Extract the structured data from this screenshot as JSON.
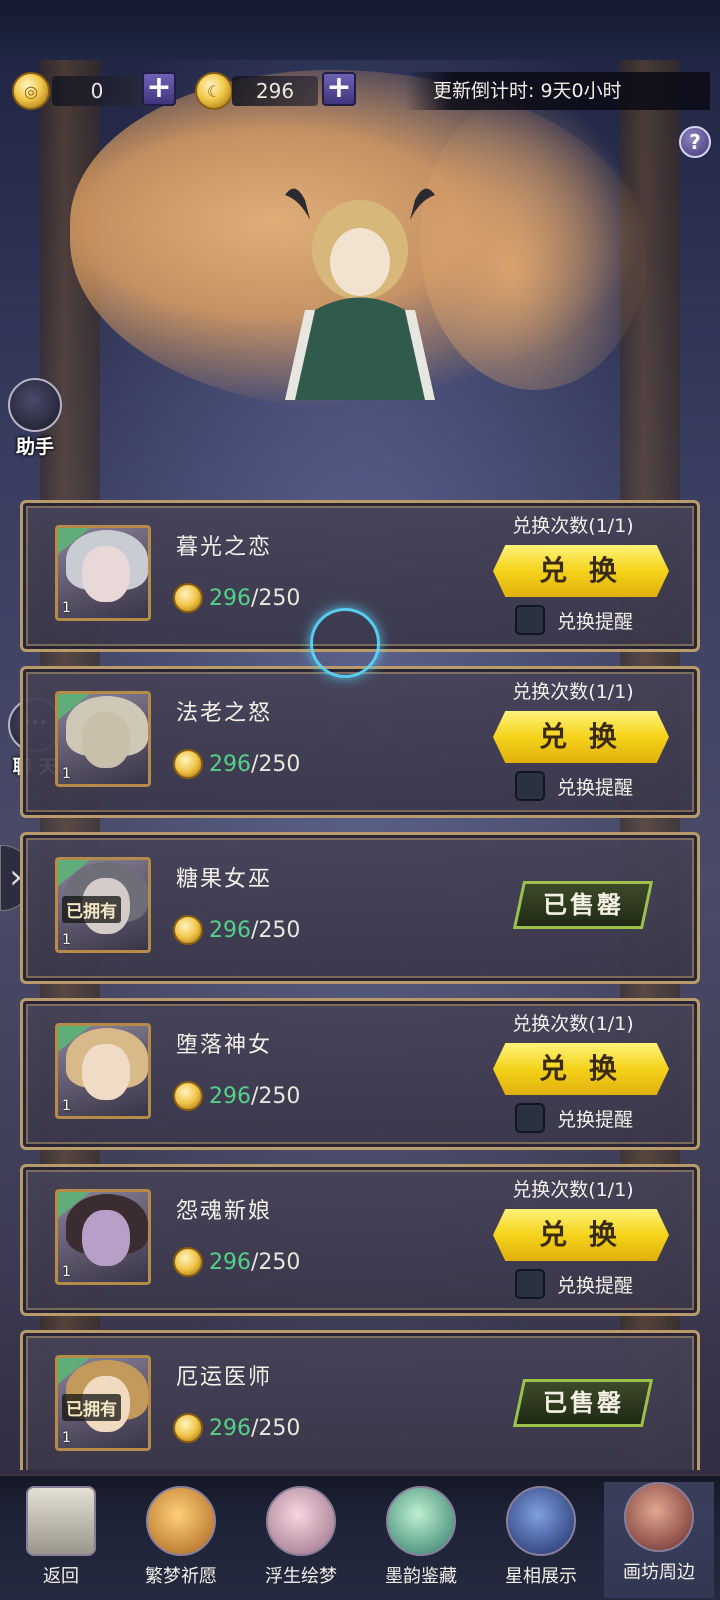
{
  "currency": {
    "primary": {
      "icon": "coin-icon",
      "amount": "0"
    },
    "secondary": {
      "icon": "gold-coin-icon",
      "amount": "296"
    },
    "refresh_label": "更新倒计时: 9天0小时"
  },
  "help_icon": "question-icon",
  "side": {
    "assistant_label": "助手",
    "chat_label": "聊 天",
    "drawer_icon": "chevron-right-icon"
  },
  "items": [
    {
      "name": "暮光之恋",
      "have": "296",
      "need": "/250",
      "quantity": "1",
      "owned": false,
      "limit": "兑换次数(1/1)",
      "exchange_label": "兑 换",
      "remind_label": "兑换提醒",
      "hair": "#c9ccd3",
      "face": "#e9d8d8"
    },
    {
      "name": "法老之怒",
      "have": "296",
      "need": "/250",
      "quantity": "1",
      "owned": false,
      "limit": "兑换次数(1/1)",
      "exchange_label": "兑 换",
      "remind_label": "兑换提醒",
      "hair": "#cfc8b6",
      "face": "#c8c0aa"
    },
    {
      "name": "糖果女巫",
      "have": "296",
      "need": "/250",
      "quantity": "1",
      "owned": true,
      "owned_label": "已拥有",
      "sold_label": "已售罄",
      "hair": "#6e6e78",
      "face": "#d4ccc8"
    },
    {
      "name": "堕落神女",
      "have": "296",
      "need": "/250",
      "quantity": "1",
      "owned": false,
      "limit": "兑换次数(1/1)",
      "exchange_label": "兑 换",
      "remind_label": "兑换提醒",
      "hair": "#d7b98a",
      "face": "#f0dcc6"
    },
    {
      "name": "怨魂新娘",
      "have": "296",
      "need": "/250",
      "quantity": "1",
      "owned": false,
      "limit": "兑换次数(1/1)",
      "exchange_label": "兑 换",
      "remind_label": "兑换提醒",
      "hair": "#3a2c30",
      "face": "#b6a0c8"
    },
    {
      "name": "厄运医师",
      "have": "296",
      "need": "/250",
      "quantity": "1",
      "owned": true,
      "owned_label": "已拥有",
      "sold_label": "已售罄",
      "hair": "#c39a5c",
      "face": "#f0dac0"
    }
  ],
  "nav": [
    {
      "label": "返回",
      "icon": "back-arrow-icon"
    },
    {
      "label": "繁梦祈愿",
      "icon": "lantern-icon"
    },
    {
      "label": "浮生绘梦",
      "icon": "flower-icon"
    },
    {
      "label": "墨韵鉴藏",
      "icon": "butterfly-orb-icon"
    },
    {
      "label": "星相展示",
      "icon": "astrolabe-icon"
    },
    {
      "label": "画坊周边",
      "icon": "shop-cart-icon"
    }
  ],
  "active_nav": "画坊周边"
}
